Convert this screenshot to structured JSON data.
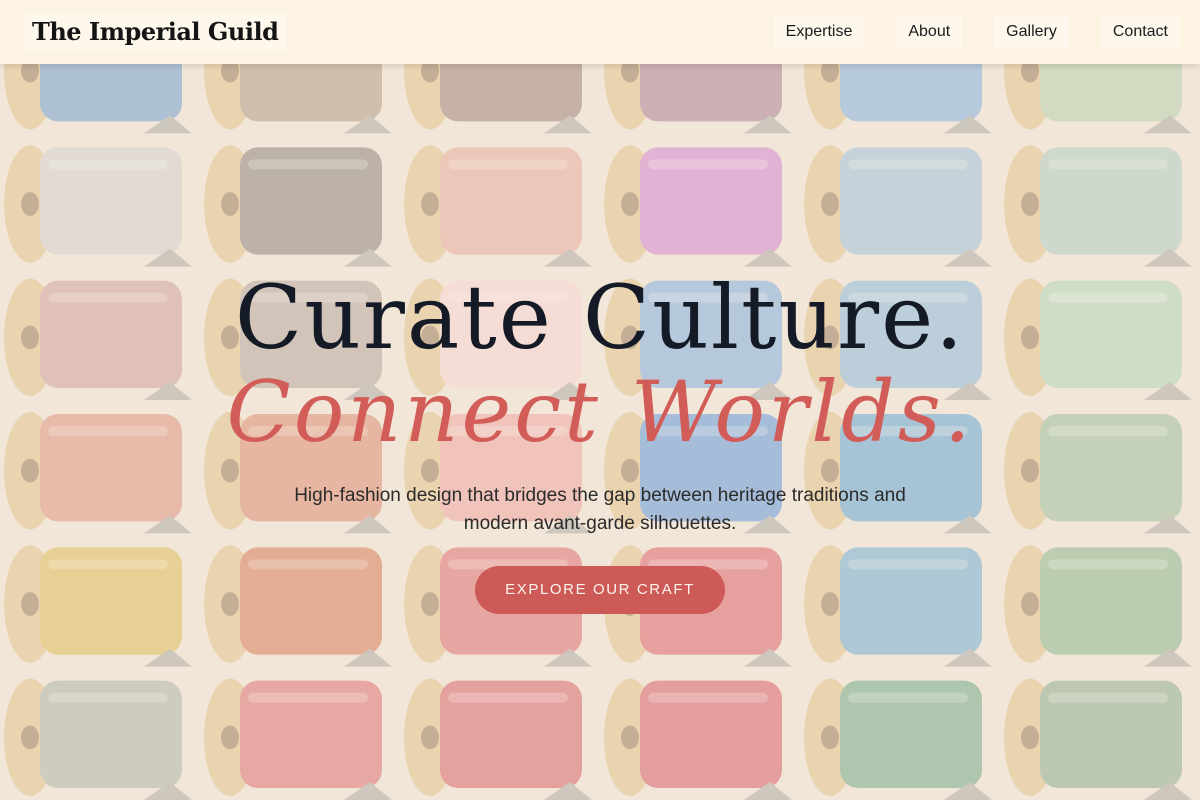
{
  "navbar": {
    "logo": "The Imperial Guild",
    "links": [
      {
        "label": "Expertise"
      },
      {
        "label": "About"
      },
      {
        "label": "Gallery"
      },
      {
        "label": "Contact"
      }
    ]
  },
  "hero": {
    "headline_line1": "Curate Culture.",
    "headline_line2": "Connect Worlds.",
    "subtitle": "High-fashion design that bridges the gap between heritage traditions and modern avant-garde silhouettes.",
    "cta_label": "EXPLORE OUR CRAFT"
  },
  "colors": {
    "accent": "#cd5a57",
    "headline_dark": "#141a26",
    "nav_background": "#fcf3e3"
  },
  "background": {
    "thread_columns": [
      [
        "#5c8fc4",
        "#c6c4c2",
        "#c48e88",
        "#d4816e",
        "#d4ad3e",
        "#9fa697"
      ],
      [
        "#a48a74",
        "#7c7066",
        "#a8958c",
        "#d1785c",
        "#c9653e",
        "#d35b61"
      ],
      [
        "#8c6e62",
        "#dd9c8d",
        "#f0c6c4",
        "#e99590",
        "#d5565d",
        "#cf4b55"
      ],
      [
        "#9d6b86",
        "#c76fc2",
        "#6e9ed4",
        "#4b86cf",
        "#d14b57",
        "#ce4552"
      ],
      [
        "#6fa0d6",
        "#8eb2cf",
        "#7aaad2",
        "#4f94c8",
        "#5d9dc6",
        "#5d9a74"
      ],
      [
        "#a8c49e",
        "#9fbeb4",
        "#a3c8a8",
        "#8bb08a",
        "#7aa67a",
        "#7a9e7c"
      ]
    ]
  }
}
